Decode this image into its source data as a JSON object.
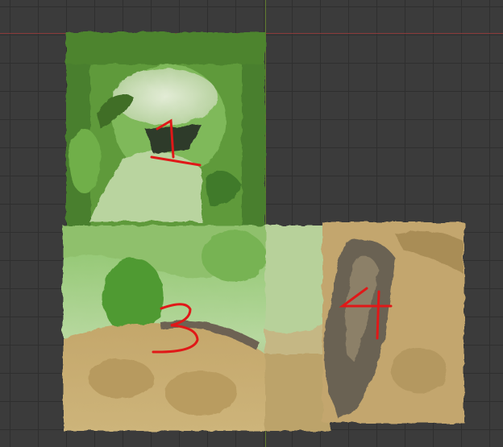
{
  "viewport": {
    "background": "#3b3b3b",
    "grid_color": "#2f2f2f",
    "x_axis_color": "#8a3a3a",
    "y_axis_color": "#5f7a2e"
  },
  "terrain": {
    "tile_colors": {
      "green_dark": "#4f8a2f",
      "green_mid": "#6fae4a",
      "green_light": "#a9cf92",
      "pale": "#d7e3c8",
      "sand": "#c9ae72",
      "sand_dark": "#9d8453",
      "rock": "#6d6252"
    }
  },
  "annotations": [
    {
      "label": "1",
      "color": "#e01818"
    },
    {
      "label": "3",
      "color": "#e01818"
    },
    {
      "label": "4",
      "color": "#e01818"
    }
  ]
}
